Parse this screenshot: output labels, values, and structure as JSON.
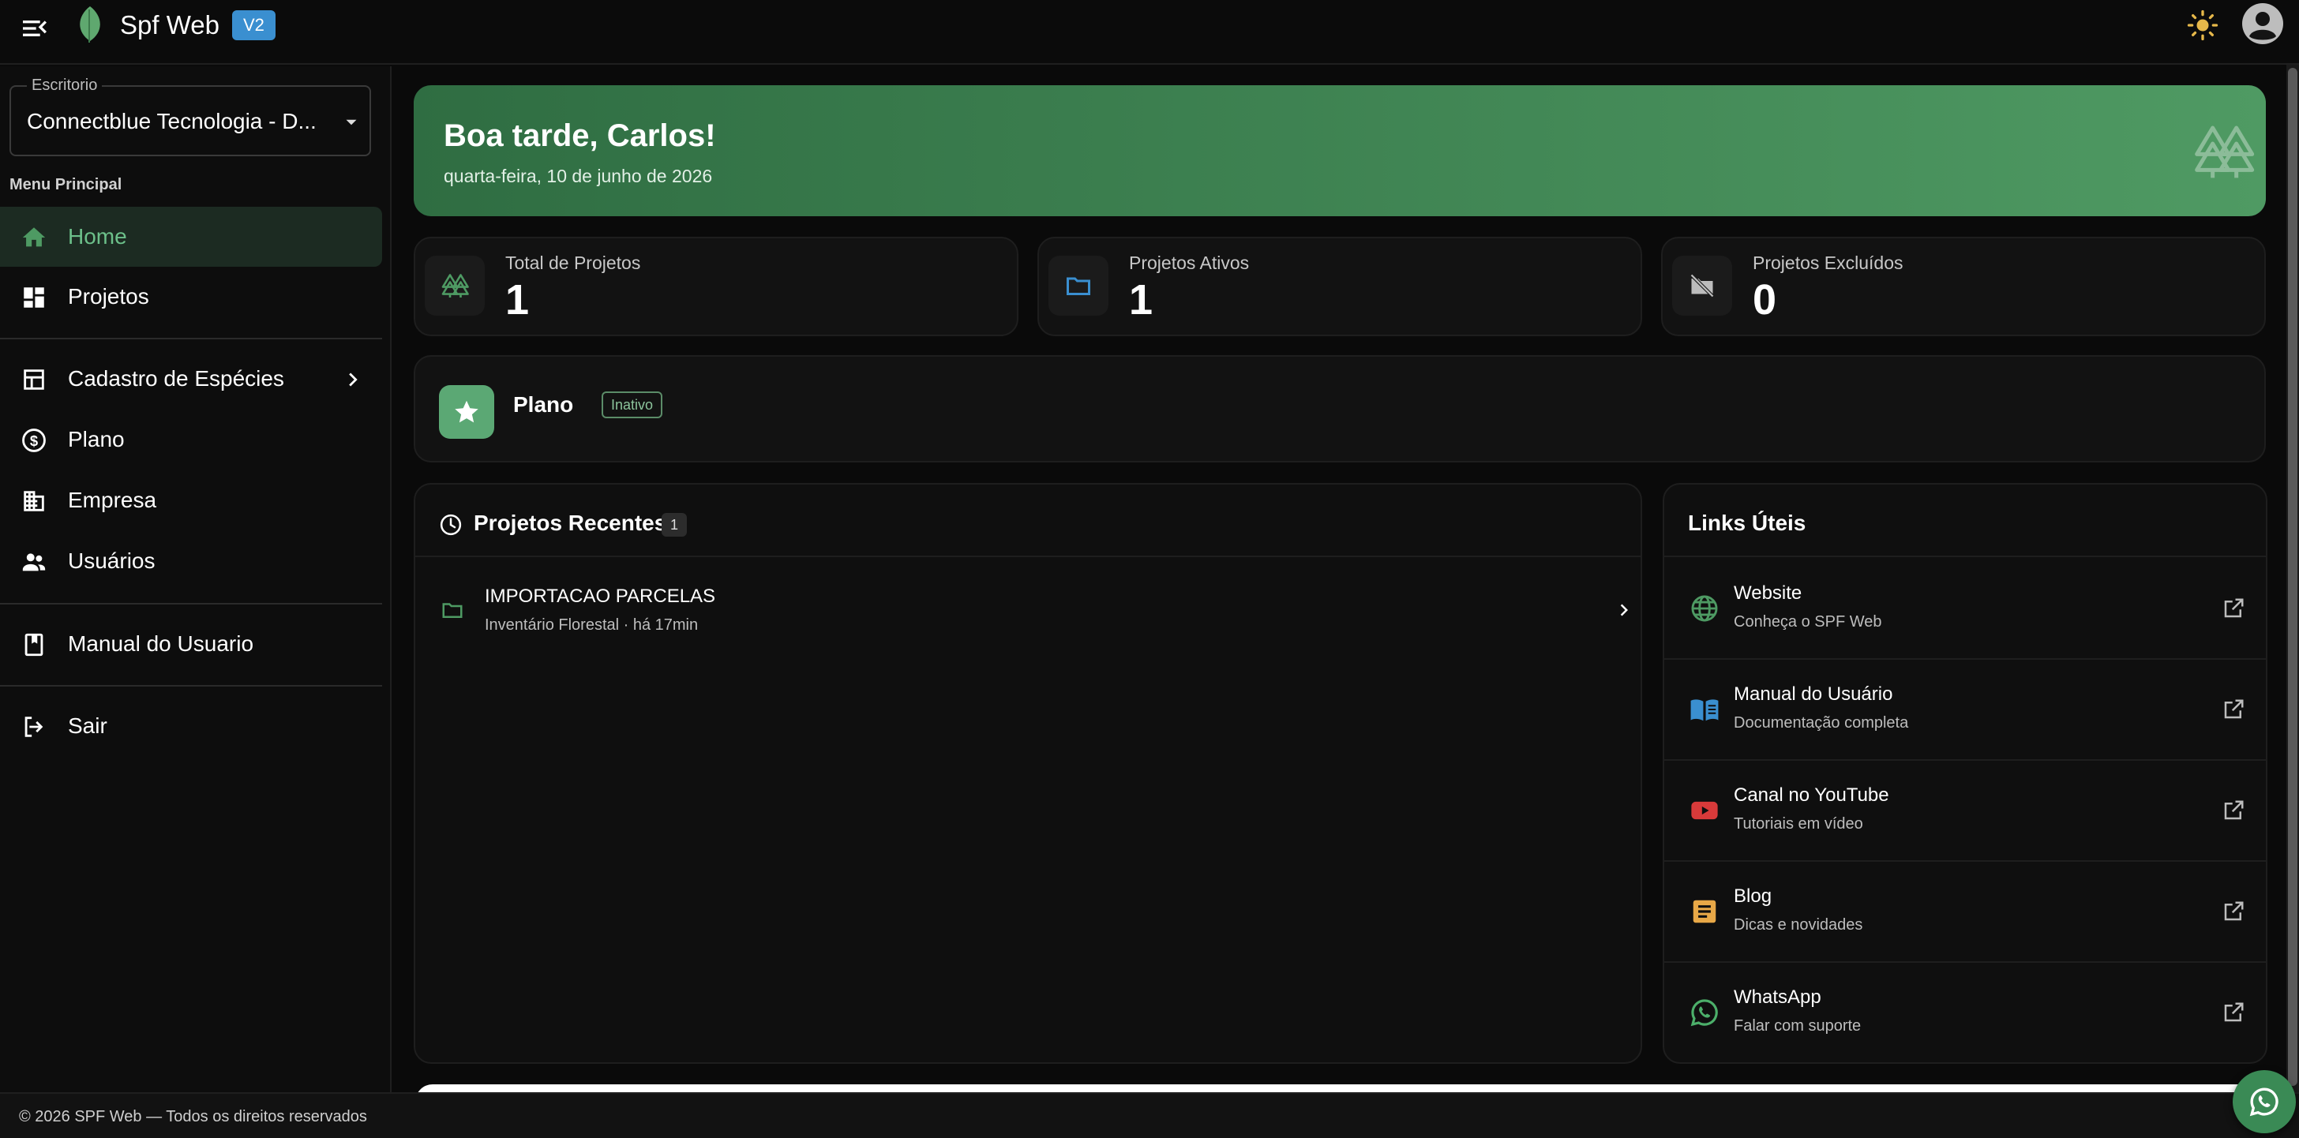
{
  "app": {
    "title": "Spf Web",
    "version": "V2"
  },
  "sidebar": {
    "office_label": "Escritorio",
    "office_value": "Connectblue Tecnologia - D...",
    "section_title": "Menu Principal",
    "items": [
      {
        "label": "Home",
        "icon": "home-icon",
        "active": true
      },
      {
        "label": "Projetos",
        "icon": "dashboard-icon"
      },
      {
        "label": "Cadastro de Espécies",
        "icon": "table-icon"
      },
      {
        "label": "Plano",
        "icon": "dollar-circle-icon"
      },
      {
        "label": "Empresa",
        "icon": "building-icon"
      },
      {
        "label": "Usuários",
        "icon": "users-icon"
      },
      {
        "label": "Manual do Usuario",
        "icon": "book-icon"
      },
      {
        "label": "Sair",
        "icon": "logout-icon"
      }
    ]
  },
  "greeting": {
    "title": "Boa tarde, Carlos!",
    "date": "quarta-feira, 10 de junho de 2026"
  },
  "stats": [
    {
      "label": "Total de Projetos",
      "value": "1",
      "icon": "trees-icon"
    },
    {
      "label": "Projetos Ativos",
      "value": "1",
      "icon": "folder-icon"
    },
    {
      "label": "Projetos Excluídos",
      "value": "0",
      "icon": "folder-off-icon"
    }
  ],
  "plan": {
    "title": "Plano",
    "badge": "Inativo"
  },
  "recent": {
    "title": "Projetos Recentes",
    "count": "1",
    "items": [
      {
        "title": "IMPORTACAO PARCELAS",
        "subtitle": "Inventário Florestal · há 17min"
      }
    ]
  },
  "links": {
    "title": "Links Úteis",
    "items": [
      {
        "title": "Website",
        "subtitle": "Conheça o SPF Web",
        "icon": "globe-icon",
        "color": "#4e9a63"
      },
      {
        "title": "Manual do Usuário",
        "subtitle": "Documentação completa",
        "icon": "book-open-icon",
        "color": "#3a8fd0"
      },
      {
        "title": "Canal no YouTube",
        "subtitle": "Tutoriais em vídeo",
        "icon": "youtube-icon",
        "color": "#d83a3a"
      },
      {
        "title": "Blog",
        "subtitle": "Dicas e novidades",
        "icon": "article-icon",
        "color": "#e8a847"
      },
      {
        "title": "WhatsApp",
        "subtitle": "Falar com suporte",
        "icon": "whatsapp-icon",
        "color": "#4caf6a"
      }
    ]
  },
  "footer": {
    "text": "© 2026 SPF Web — Todos os direitos reservados"
  },
  "colors": {
    "accent": "#4e9a63",
    "active_nav_bg": "#1c2b22",
    "background": "#0a0a0a"
  }
}
